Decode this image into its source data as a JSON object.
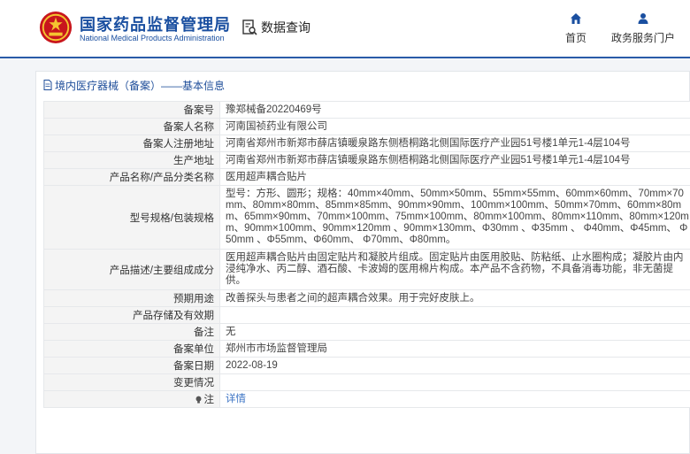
{
  "header": {
    "title_cn": "国家药品监督管理局",
    "title_en": "National Medical Products Administration",
    "query_label": "数据查询",
    "nav": {
      "home": "首页",
      "portal": "政务服务门户"
    }
  },
  "breadcrumb": "境内医疗器械（备案）——基本信息",
  "fields": [
    {
      "label": "备案号",
      "value": "豫郑械备20220469号"
    },
    {
      "label": "备案人名称",
      "value": "河南国祯药业有限公司"
    },
    {
      "label": "备案人注册地址",
      "value": "河南省郑州市新郑市薛店镇暖泉路东侧梧桐路北侧国际医疗产业园51号楼1单元1-4层104号"
    },
    {
      "label": "生产地址",
      "value": "河南省郑州市新郑市薛店镇暖泉路东侧梧桐路北侧国际医疗产业园51号楼1单元1-4层104号"
    },
    {
      "label": "产品名称/产品分类名称",
      "value": "医用超声耦合贴片"
    },
    {
      "label": "型号规格/包装规格",
      "value": "型号：方形、圆形；规格：40mm×40mm、50mm×50mm、55mm×55mm、60mm×60mm、70mm×70mm、80mm×80mm、85mm×85mm、90mm×90mm、100mm×100mm、50mm×70mm、60mm×80mm、65mm×90mm、70mm×100mm、75mm×100mm、80mm×100mm、80mm×110mm、80mm×120mm、90mm×100mm、90mm×120mm 、90mm×130mm、Φ30mm 、Φ35mm 、 Φ40mm、Φ45mm、 Φ50mm 、Φ55mm、Φ60mm、 Φ70mm、Φ80mm。"
    },
    {
      "label": "产品描述/主要组成成分",
      "value": "医用超声耦合贴片由固定贴片和凝胶片组成。固定贴片由医用胶贴、防粘纸、止水圈构成；凝胶片由内浸纯净水、丙二醇、酒石酸、卡波姆的医用棉片构成。本产品不含药物，不具备消毒功能，非无菌提供。"
    },
    {
      "label": "预期用途",
      "value": "改善探头与患者之间的超声耦合效果。用于完好皮肤上。"
    },
    {
      "label": "产品存储及有效期",
      "value": ""
    },
    {
      "label": "备注",
      "value": "无"
    },
    {
      "label": "备案单位",
      "value": "郑州市市场监督管理局"
    },
    {
      "label": "备案日期",
      "value": "2022-08-19"
    },
    {
      "label": "变更情况",
      "value": ""
    },
    {
      "label": "注",
      "value": "详情"
    }
  ]
}
